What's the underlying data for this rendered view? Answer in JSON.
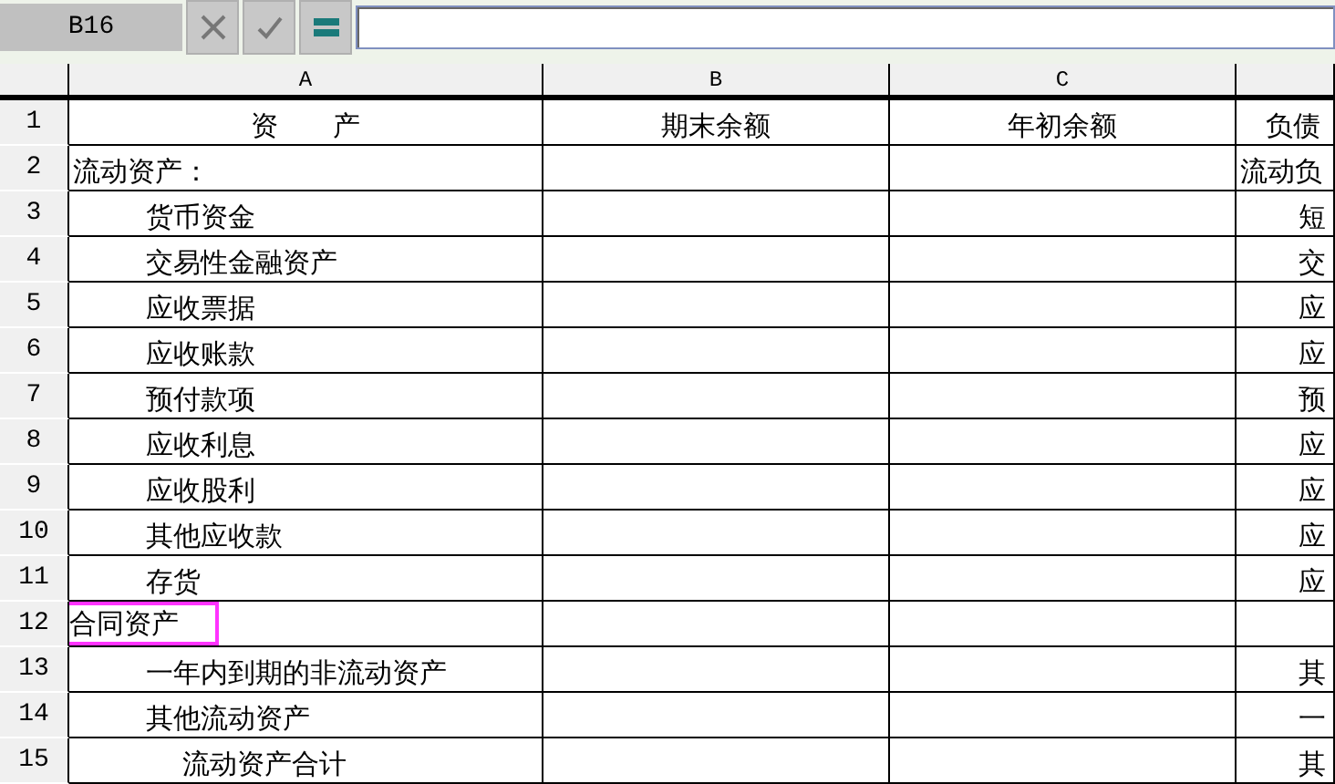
{
  "formula_bar": {
    "cell_reference": "B16"
  },
  "columns": [
    "A",
    "B",
    "C"
  ],
  "header_row": {
    "number": "1",
    "cells": [
      "资　　产",
      "期末余额",
      "年初余额",
      "负债"
    ]
  },
  "rows": [
    {
      "number": "2",
      "kind": "heading",
      "label": "流动资产：",
      "highlighted": false,
      "column_d": "流动负"
    },
    {
      "number": "3",
      "kind": "item",
      "label": "货币资金",
      "highlighted": false,
      "column_d": "短"
    },
    {
      "number": "4",
      "kind": "item",
      "label": "交易性金融资产",
      "highlighted": false,
      "column_d": "交"
    },
    {
      "number": "5",
      "kind": "item",
      "label": "应收票据",
      "highlighted": false,
      "column_d": "应"
    },
    {
      "number": "6",
      "kind": "item",
      "label": "应收账款",
      "highlighted": false,
      "column_d": "应"
    },
    {
      "number": "7",
      "kind": "item",
      "label": "预付款项",
      "highlighted": false,
      "column_d": "预"
    },
    {
      "number": "8",
      "kind": "item",
      "label": "应收利息",
      "highlighted": false,
      "column_d": "应"
    },
    {
      "number": "9",
      "kind": "item",
      "label": "应收股利",
      "highlighted": false,
      "column_d": "应"
    },
    {
      "number": "10",
      "kind": "item",
      "label": "其他应收款",
      "highlighted": false,
      "column_d": "应"
    },
    {
      "number": "11",
      "kind": "item",
      "label": "存货",
      "highlighted": false,
      "column_d": "应"
    },
    {
      "number": "12",
      "kind": "heading",
      "label": "合同资产",
      "highlighted": true,
      "column_d": ""
    },
    {
      "number": "13",
      "kind": "item",
      "label": "一年内到期的非流动资产",
      "highlighted": false,
      "column_d": "其"
    },
    {
      "number": "14",
      "kind": "item",
      "label": "其他流动资产",
      "highlighted": false,
      "column_d": "一"
    },
    {
      "number": "15",
      "kind": "total",
      "label": "流动资产合计",
      "highlighted": false,
      "column_d": "其"
    }
  ]
}
